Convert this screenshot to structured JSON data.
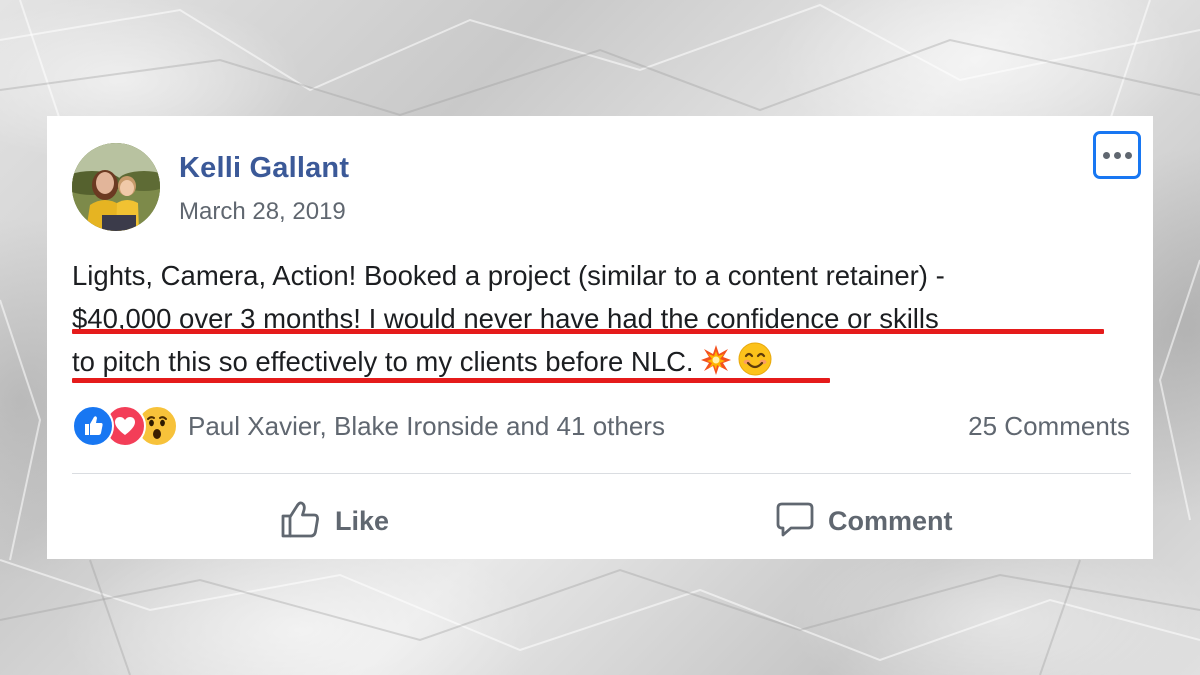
{
  "post": {
    "author": "Kelli Gallant",
    "date": "March 28, 2019",
    "lines": [
      "Lights, Camera, Action! Booked a project (similar to a content retainer) -",
      "$40,000 over 3 months! I would never have had the confidence or skills",
      "to pitch this so effectively to my clients before NLC."
    ],
    "trailing_emojis": [
      "collision-emoji",
      "smiling-face-emoji"
    ],
    "highlight_color": "#e51b1b"
  },
  "reactions": {
    "icons": [
      "like-reaction-icon",
      "love-reaction-icon",
      "wow-reaction-icon"
    ],
    "summary": "Paul Xavier, Blake Ironside and 41 others",
    "comments_count": "25 Comments"
  },
  "actions": {
    "like_label": "Like",
    "comment_label": "Comment"
  },
  "colors": {
    "author_name": "#3b5998",
    "more_button_border": "#1877f2",
    "secondary_text": "#606770"
  },
  "icons": {
    "more": "more-options-icon",
    "like": "thumbs-up-icon",
    "comment": "comment-bubble-icon"
  }
}
